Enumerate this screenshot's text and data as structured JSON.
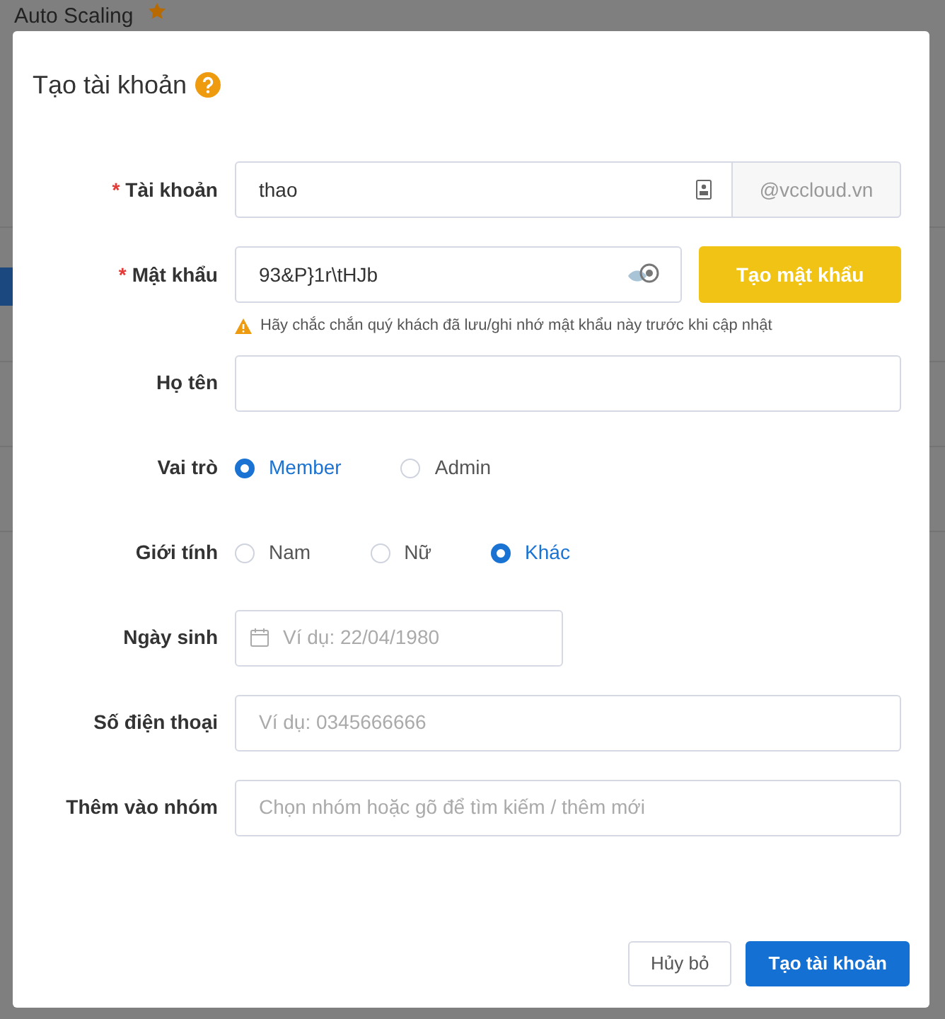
{
  "background": {
    "title": "Auto Scaling",
    "starred": true
  },
  "modal": {
    "title": "Tạo tài khoản",
    "fields": [
      {
        "kind": "addon",
        "label": "Tài khoản",
        "marker": "*",
        "value": "thao",
        "addon": "@vccloud.vn"
      },
      {
        "kind": "password",
        "label": "Mật khẩu",
        "marker": "*",
        "value": "93&P}1r\\tHJb",
        "button": "Tạo mật khẩu",
        "warning": "Hãy chắc chắn quý khách đã lưu/ghi nhớ mật khẩu này trước khi cập nhật"
      },
      {
        "kind": "text",
        "label": "Họ tên"
      },
      {
        "kind": "radio",
        "label": "Vai trò",
        "options": [
          {
            "label": "Member",
            "selected": true
          },
          {
            "label": "Admin",
            "selected": false
          }
        ]
      },
      {
        "kind": "radio",
        "label": "Giới tính",
        "options": [
          {
            "label": "Nam",
            "selected": false
          },
          {
            "label": "Nữ",
            "selected": false
          },
          {
            "label": "Khác",
            "selected": true
          }
        ]
      },
      {
        "kind": "date",
        "label": "Ngày sinh",
        "placeholder": "Ví dụ: 22/04/1980"
      },
      {
        "kind": "text",
        "label": "Số điện thoại",
        "placeholder": "Ví dụ: 0345666666"
      },
      {
        "kind": "text",
        "label": "Thêm vào nhóm",
        "placeholder": "Chọn nhóm hoặc gõ để tìm kiếm / thêm mới"
      }
    ],
    "buttons": [
      {
        "kind": "secondary",
        "label": "Hủy bỏ"
      },
      {
        "kind": "primary",
        "label": "Tạo tài khoản"
      }
    ]
  }
}
